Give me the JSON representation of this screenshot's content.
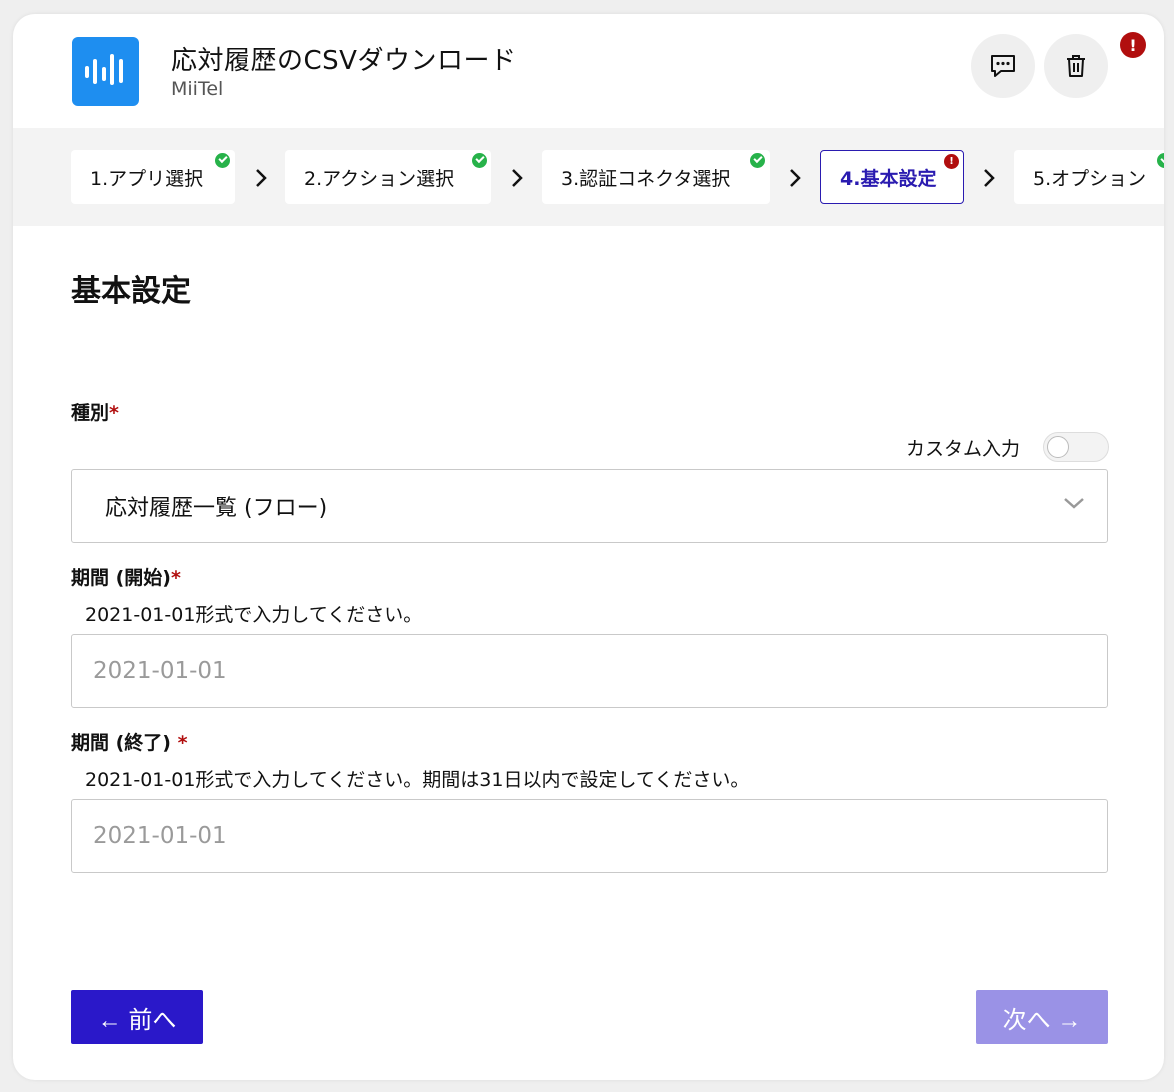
{
  "header": {
    "title": "応対履歴のCSVダウンロード",
    "subtitle": "MiiTel",
    "app_icon": "audio-wave-icon",
    "comment_icon": "comment-icon",
    "trash_icon": "trash-icon",
    "alert_badge": "!"
  },
  "stepper": {
    "steps": [
      {
        "label": "1.アプリ選択",
        "status": "done"
      },
      {
        "label": "2.アクション選択",
        "status": "done"
      },
      {
        "label": "3.認証コネクタ選択",
        "status": "done"
      },
      {
        "label": "4.基本設定",
        "status": "error"
      },
      {
        "label": "5.オプション",
        "status": "done"
      }
    ],
    "error_mark": "!"
  },
  "form": {
    "section_title": "基本設定",
    "type_field": {
      "label": "種別",
      "required_mark": "*",
      "custom_input_label": "カスタム入力",
      "custom_input_on": false,
      "selected_value": "応対履歴一覧 (フロー)"
    },
    "start_field": {
      "label": "期間 (開始)",
      "required_mark": "*",
      "hint": "2021-01-01形式で入力してください。",
      "placeholder": "2021-01-01"
    },
    "end_field": {
      "label": "期間 (終了) ",
      "required_mark": "*",
      "hint": "2021-01-01形式で入力してください。期間は31日以内で設定してください。",
      "placeholder": "2021-01-01"
    }
  },
  "footer": {
    "prev_label": "← 前へ",
    "next_label": "次へ →"
  },
  "colors": {
    "brand_primary": "#2a18c9",
    "brand_disabled": "#9a92e6",
    "success": "#27b24a",
    "error": "#b10e0e",
    "app_icon_bg": "#1e8ef0"
  }
}
